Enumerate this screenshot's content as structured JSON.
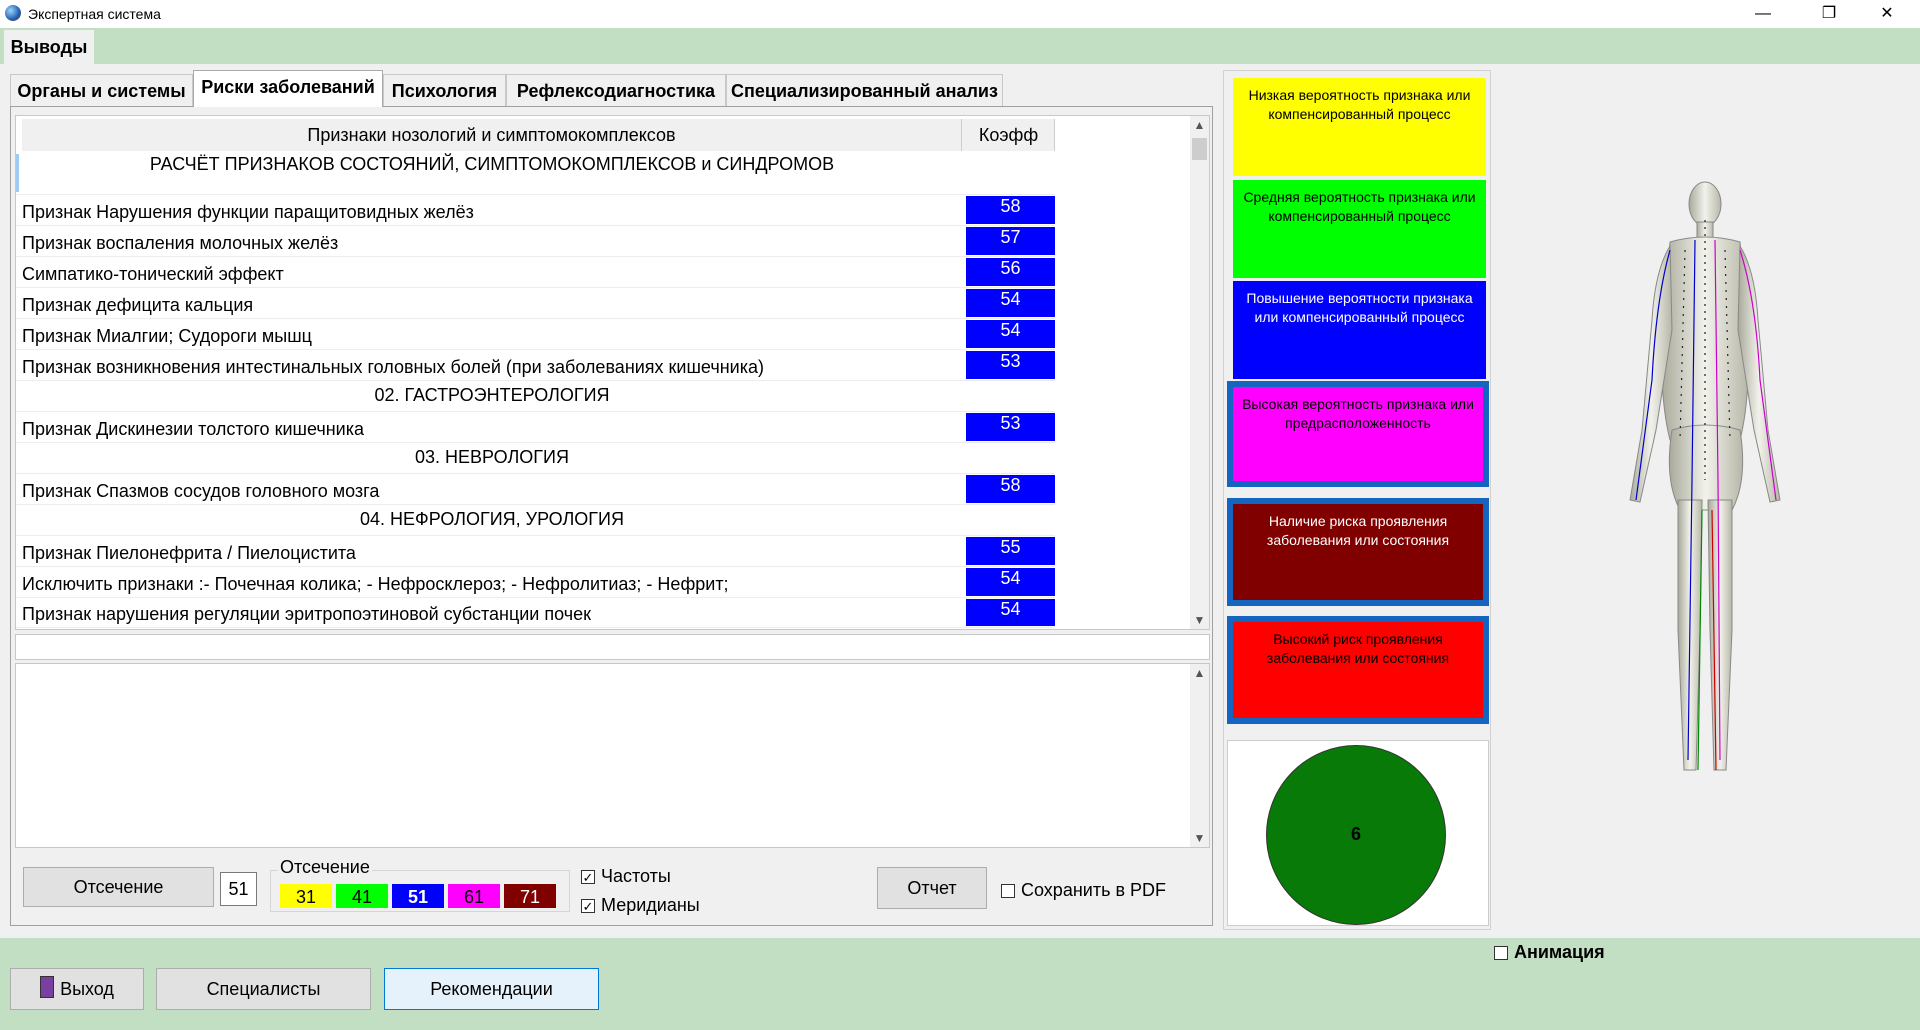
{
  "window": {
    "title": "Экспертная система"
  },
  "top_tabs": [
    {
      "label": "Выводы"
    }
  ],
  "inner_tabs": [
    {
      "label": "Органы и системы"
    },
    {
      "label": "Риски заболеваний",
      "active": true
    },
    {
      "label": "Психология"
    },
    {
      "label": "Рефлексодиагностика"
    },
    {
      "label": "Специализированный анализ"
    }
  ],
  "grid": {
    "header_name": "Признаки нозологий и симптомокомплексов",
    "header_coef": "Коэфф",
    "title_row": "РАСЧЁТ  ПРИЗНАКОВ  СОСТОЯНИЙ,  СИМПТОМОКОМПЛЕКСОВ  и  СИНДРОМОВ",
    "rows": [
      {
        "name": "Признак Нарушения функции паращитовидных желёз",
        "coef": "58"
      },
      {
        "name": "Признак воспаления молочных желёз",
        "coef": "57"
      },
      {
        "name": "Симпатико-тонический эффект",
        "coef": "56"
      },
      {
        "name": "Признак дефицита кальция",
        "coef": "54"
      },
      {
        "name": "Признак Миалгии; Судороги мышц",
        "coef": "54"
      },
      {
        "name": "Признак  возникновения интестинальных головных болей (при заболеваниях кишечника)",
        "coef": "53"
      },
      {
        "section": "02. ГАСТРОЭНТЕРОЛОГИЯ"
      },
      {
        "name": "Признак Дискинезии толстого кишечника",
        "coef": "53"
      },
      {
        "section": "03. НЕВРОЛОГИЯ"
      },
      {
        "name": "Признак Спазмов сосудов головного мозга",
        "coef": "58"
      },
      {
        "section": "04. НЕФРОЛОГИЯ, УРОЛОГИЯ"
      },
      {
        "name": "Признак Пиелонефрита / Пиелоцистита",
        "coef": "55"
      },
      {
        "name": "Исключить признаки :- Почечная колика; - Нефросклероз; - Нефролитиаз; - Нефрит;",
        "coef": "54"
      },
      {
        "name": "Признак нарушения регуляции эритропоэтиновой субстанции почек",
        "coef": "54"
      }
    ]
  },
  "controls": {
    "cut_button": "Отсечение",
    "cut_value": "51",
    "cut_group_label": "Отсечение",
    "cut_swatches": [
      {
        "value": "31",
        "color": "#ffff00",
        "text_color": "#000000"
      },
      {
        "value": "41",
        "color": "#00ff00",
        "text_color": "#000000"
      },
      {
        "value": "51",
        "color": "#0000ff",
        "text_color": "#ffffff"
      },
      {
        "value": "61",
        "color": "#ff00ff",
        "text_color": "#000000"
      },
      {
        "value": "71",
        "color": "#800000",
        "text_color": "#ffffff"
      }
    ],
    "freq_label": "Частоты",
    "freq_checked": true,
    "meridians_label": "Меридианы",
    "meridians_checked": true,
    "report_button": "Отчет",
    "save_pdf_label": "Сохранить в PDF",
    "save_pdf_checked": false
  },
  "legend": [
    {
      "text": "Низкая вероятность признака или компенсированный процесс",
      "bg": "#ffff00",
      "color": "#000000"
    },
    {
      "text": "Средняя вероятность признака или компенсированный процесс",
      "bg": "#00ff00",
      "color": "#000000"
    },
    {
      "text": "Повышение вероятности признака или компенсированный процесс",
      "bg": "#0000ff",
      "color": "#ffffff"
    },
    {
      "text": "Высокая вероятность признака или предрасположенность",
      "bg": "#ff00ff",
      "color": "#000000"
    },
    {
      "text": "Наличие риска проявления заболевания или состояния",
      "bg": "#800000",
      "color": "#ffffff"
    },
    {
      "text": "Высокий риск проявления заболевания или состояния",
      "bg": "#ff0000",
      "color": "#000000"
    }
  ],
  "indicator": {
    "value": "6",
    "color": "#087a08"
  },
  "animation": {
    "label": "Анимация",
    "checked": false
  },
  "bottom_buttons": {
    "exit": "Выход",
    "specialists": "Специалисты",
    "recommendations": "Рекомендации"
  }
}
